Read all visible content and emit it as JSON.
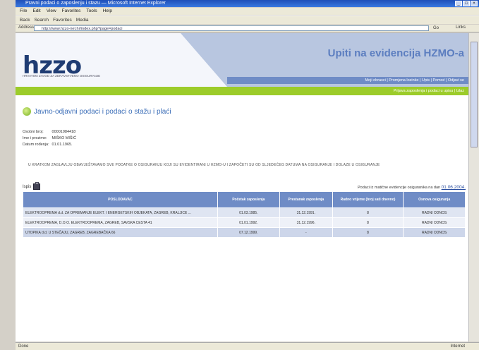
{
  "browser": {
    "title": "Pravni podaci o zaposlenju i stazu — Microsoft Internet Explorer",
    "menu": [
      "File",
      "Edit",
      "View",
      "Favorites",
      "Tools",
      "Help"
    ],
    "toolbar": [
      "Back",
      "Search",
      "Favorites",
      "Media"
    ],
    "address_label": "Address",
    "address_value": "http://www.hzzo-net.hr/index.php?page=podaci",
    "go_label": "Go",
    "links_label": "Links",
    "status_left": "Done",
    "status_zone": "Internet"
  },
  "site": {
    "logo": "hzzo",
    "logo_sub": "HRVATSKI ZAVOD ZA ZDRAVSTVENO OSIGURANJE",
    "title": "Upiti na evidencija HZMO-a",
    "nav": "Moji obrasci | Promjena lozinke | Upis | Pomoć | Odjavi se",
    "green_bar": "Prijava zaposlenja i podaci u upisu | Izlaz"
  },
  "page": {
    "title": "Javno-odjavni podaci i podaci o stažu i plaći",
    "info": [
      {
        "label": "Osobni broj:",
        "value": "00001984418"
      },
      {
        "label": "Ime i prezime:",
        "value": "MIŠKO MIŠIĆ"
      },
      {
        "label": "Datum rođenja:",
        "value": "01.01.1965."
      }
    ],
    "notice": "U KRATKOM ZAGLAVLJU OBAVJEŠTAVAMO SVE PODATKE O OSIGURANJU KOJI SU EVIDENTIRANI U HZMO-U I ZAPOČETI SU OD SLJEDEĆEG DATUMA NA OSIGURANJE I DOLAZE U OSIGURANJE",
    "ispis_label": "Ispis",
    "date_note": "Podaci iz matične evidencije osiguranika na dan",
    "date_value": "01.06.2004."
  },
  "table": {
    "headers": [
      "POSLODAVAC",
      "Početak zaposlenja",
      "Prestanak zaposlenja",
      "Radno vrijeme (broj sati dnevno)",
      "Osnova osiguranja"
    ],
    "rows": [
      [
        "ELEKTROOPREMA d.d. ZA OPREMANJE ELEKT. I ENERGETSKIH OBJEKATA, ZAGREB, KRALJICE ...",
        "01.03.1985.",
        "31.12.1991.",
        "8",
        "RADNI ODNOS"
      ],
      [
        "ELEKTROOPREMA, D.O.O. ELEKTROOPREMA, ZAGREB, SAVSKA CESTA 41",
        "01.01.1992.",
        "31.12.1996.",
        "8",
        "RADNI ODNOS"
      ],
      [
        "UTOPIKA d.d. U STEČAJU, ZAGREB, ZAGREBAČKA 66",
        "07.12.1999.",
        "-",
        "8",
        "RADNI ODNOS"
      ]
    ]
  }
}
